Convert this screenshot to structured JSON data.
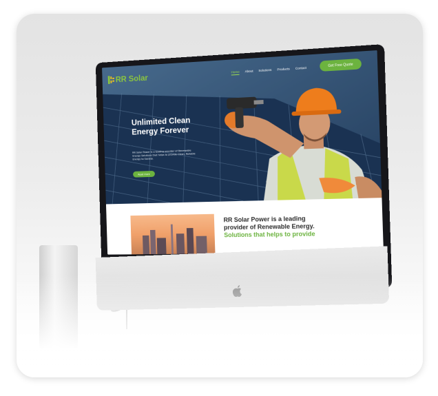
{
  "website": {
    "logo": {
      "text": "RR Solar",
      "tagline": ""
    },
    "nav": {
      "links": [
        "Home",
        "About",
        "Solutions",
        "Products",
        "Contact"
      ],
      "active": "Home",
      "cta": "Get Free Quote"
    },
    "hero": {
      "title_line1": "Unlimited Clean",
      "title_line2": "Energy Forever",
      "body": "RR Solar Power is a leading provider of Renewable Energy Solutions that helps to provide Clean, Reliable Energy to Society.",
      "button": "Read more"
    },
    "about": {
      "line1": "RR Solar Power is a leading",
      "line2": "provider of Renewable Energy.",
      "line3": "Solutions that helps to provide"
    }
  },
  "colors": {
    "brand_green": "#6cb33f",
    "logo_green": "#8bc53f",
    "hero_blue": "#34567a",
    "helmet_orange": "#ee7d1c"
  },
  "icons": [
    "sun-logo-icon",
    "apple-logo-icon",
    "power-drill-icon"
  ]
}
